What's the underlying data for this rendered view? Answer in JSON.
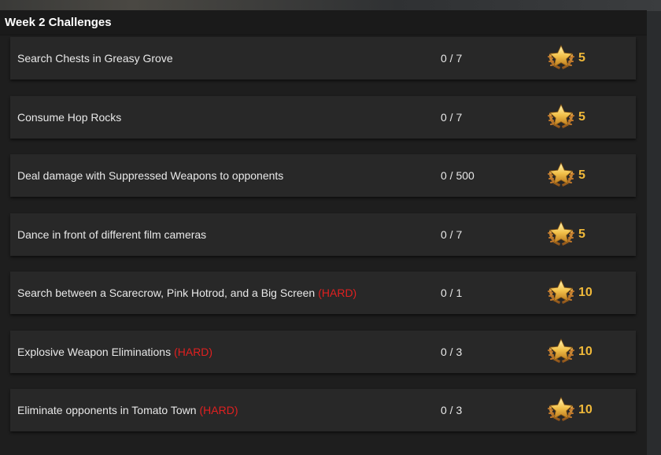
{
  "panel": {
    "title": "Week 2 Challenges"
  },
  "challenges": [
    {
      "task": "Search Chests in Greasy Grove",
      "tag": "",
      "progress": "0 / 7",
      "stars": "5"
    },
    {
      "task": "Consume Hop Rocks",
      "tag": "",
      "progress": "0 / 7",
      "stars": "5"
    },
    {
      "task": "Deal damage with Suppressed Weapons to opponents",
      "tag": "",
      "progress": "0 / 500",
      "stars": "5"
    },
    {
      "task": "Dance in front of different film cameras",
      "tag": "",
      "progress": "0 / 7",
      "stars": "5"
    },
    {
      "task": "Search between a Scarecrow, Pink Hotrod, and a Big Screen",
      "tag": "(HARD)",
      "progress": "0 / 1",
      "stars": "10"
    },
    {
      "task": "Explosive Weapon Eliminations",
      "tag": "(HARD)",
      "progress": "0 / 3",
      "stars": "10"
    },
    {
      "task": "Eliminate opponents in Tomato Town",
      "tag": "(HARD)",
      "progress": "0 / 3",
      "stars": "10"
    }
  ],
  "colors": {
    "hard": "#e02020",
    "stars": "#f0b93a",
    "row_bg": "#282828"
  },
  "icons": {
    "reward": "battle-star-icon"
  }
}
